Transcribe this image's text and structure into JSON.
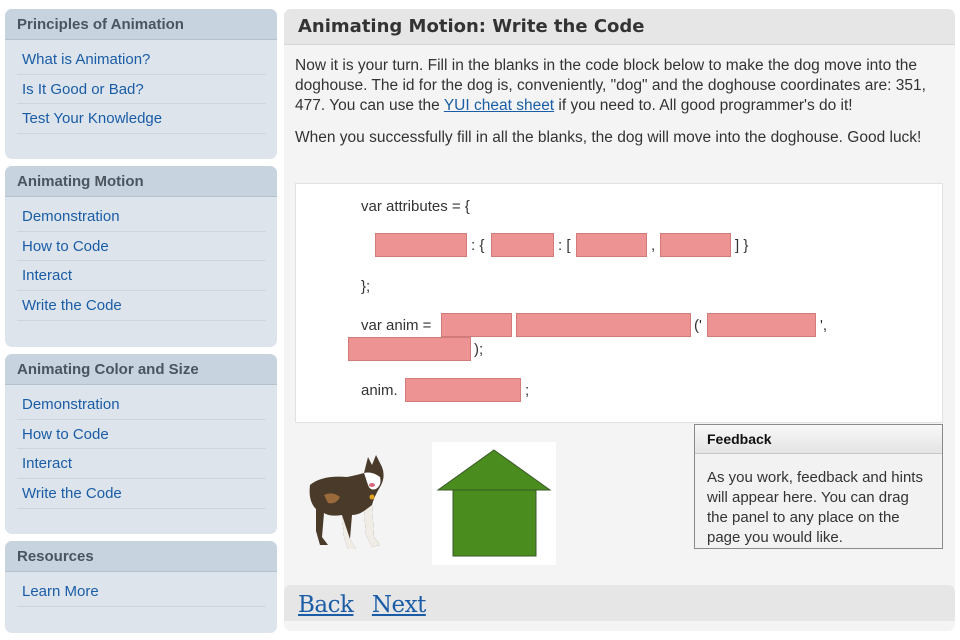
{
  "sidebar": {
    "panels": [
      {
        "title": "Principles of Animation",
        "items": [
          "What is Animation?",
          "Is It Good or Bad?",
          "Test Your Knowledge"
        ]
      },
      {
        "title": "Animating Motion",
        "items": [
          "Demonstration",
          "How to Code",
          "Interact",
          "Write the Code"
        ]
      },
      {
        "title": "Animating Color and Size",
        "items": [
          "Demonstration",
          "How to Code",
          "Interact",
          "Write the Code"
        ]
      },
      {
        "title": "Resources",
        "items": [
          "Learn More"
        ]
      }
    ]
  },
  "main": {
    "title": "Animating Motion: Write the Code",
    "intro": {
      "p1_before_link": "Now it is your turn. Fill in the blanks in the code block below to make the dog move into the doghouse. The id for the dog is, conveniently, \"dog\" and the doghouse coordinates are: 351, 477. You can use the ",
      "p1_link": "YUI cheat sheet",
      "p1_after_link": " if you need to. All good programmer's do it!",
      "p2": "When you successfully fill in all the blanks, the dog will move into the doghouse. Good luck!"
    },
    "code": {
      "line1": "var attributes = {",
      "sep_colon_brace": ": {",
      "sep_colon_bracket": ": [",
      "sep_comma": ",",
      "sep_close": "] }",
      "line3": "};",
      "anim_prefix": "var anim =",
      "paren_quote": "('",
      "quote_comma": "',",
      "close_paren": ");",
      "anim_call_prefix": "anim.",
      "semicolon": ";"
    },
    "feedback": {
      "title": "Feedback",
      "body": "As you work, feedback and hints will appear here. You can drag the panel to any place on the page you would like."
    },
    "nav": {
      "back": "Back",
      "next": "Next"
    }
  },
  "colors": {
    "link": "#1a5da6",
    "blank_fill": "#ee9393",
    "doghouse_green": "#4a8c1e",
    "sidebar_panel": "#dde4ec",
    "sidebar_header": "#c7d3de"
  }
}
